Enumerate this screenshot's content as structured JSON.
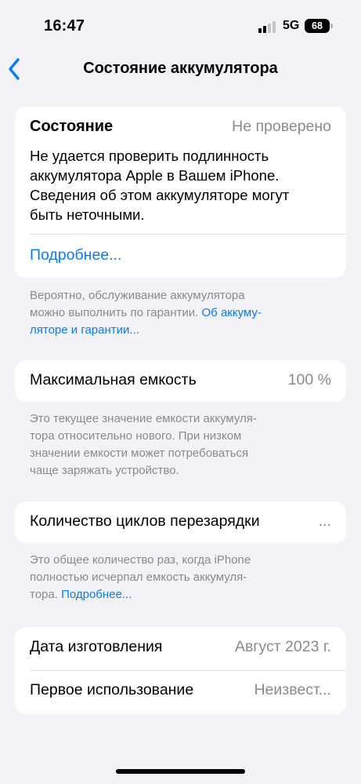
{
  "status_bar": {
    "time": "16:47",
    "network": "5G",
    "battery": "68"
  },
  "nav": {
    "title": "Состояние аккумулятора"
  },
  "condition_card": {
    "label": "Состояние",
    "value": "Не проверено",
    "message_lines": [
      "Не удается проверить подлинность",
      "аккумулятора Apple в Вашем iPhone.",
      "Сведения об этом аккумуляторе могут",
      "быть неточными."
    ],
    "more_link": "Подробнее..."
  },
  "condition_footnote": {
    "line1": "Вероятно, обслуживание аккумулятора",
    "line2_text": "можно выполнить по гарантии. ",
    "line2_link": "Об аккуму-",
    "line3_link": "ляторе и гарантии..."
  },
  "capacity_card": {
    "label": "Максимальная емкость",
    "value": "100 %"
  },
  "capacity_footnote": {
    "lines": [
      "Это текущее значение емкости аккумуля-",
      "тора относительно нового. При низком",
      "значении емкости может потребоваться",
      "чаще заряжать устройство."
    ]
  },
  "cycles_card": {
    "label": "Количество циклов перезарядки",
    "value": "..."
  },
  "cycles_footnote": {
    "line1": "Это общее количество раз, когда iPhone",
    "line2": "полностью исчерпал емкость аккумуля-",
    "line3_text": "тора. ",
    "line3_link": "Подробнее..."
  },
  "dates_card": {
    "manufacture_label": "Дата изготовления",
    "manufacture_value": "Август 2023 г.",
    "first_use_label": "Первое использование",
    "first_use_value": "Неизвест..."
  }
}
